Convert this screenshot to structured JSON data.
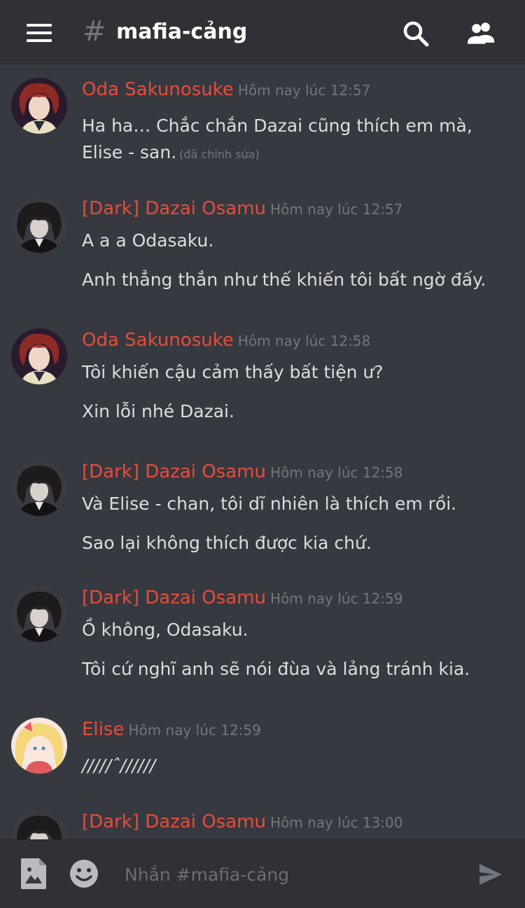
{
  "header": {
    "hash": "#",
    "channel": "mafia-cảng",
    "menu_icon": "hamburger-menu-icon",
    "search_icon": "search-icon",
    "members_icon": "members-icon"
  },
  "messages": [
    {
      "author": "Oda Sakunosuke",
      "timestamp": "Hôm nay lúc 12:57",
      "lines": [
        "Ha ha… Chắc chắn Dazai cũng thích em mà,",
        "Elise - san."
      ],
      "edited": "(đã chỉnh sửa)"
    },
    {
      "author": "[Dark] Dazai Osamu",
      "timestamp": "Hôm nay lúc 12:57",
      "lines": [
        "A a a Odasaku.",
        "Anh thẳng thắn như thế khiến tôi bất ngờ đấy."
      ]
    },
    {
      "author": "Oda Sakunosuke",
      "timestamp": "Hôm nay lúc 12:58",
      "lines": [
        "Tôi khiến cậu cảm thấy bất tiện ư?",
        "Xin lỗi nhé Dazai."
      ]
    },
    {
      "author": "[Dark] Dazai Osamu",
      "timestamp": "Hôm nay lúc 12:58",
      "lines": [
        "Và Elise - chan, tôi dĩ nhiên là thích em rồi.",
        "Sao lại không thích được kia chứ."
      ]
    },
    {
      "author": "[Dark] Dazai Osamu",
      "timestamp": "Hôm nay lúc 12:59",
      "lines": [
        "Ồ không, Odasaku.",
        "Tôi cứ nghĩ anh sẽ nói đùa và lảng tránh kia."
      ]
    },
    {
      "author": "Elise",
      "timestamp": "Hôm nay lúc 12:59",
      "lines": [
        "/////ˆ//////"
      ]
    },
    {
      "author": "[Dark] Dazai Osamu",
      "timestamp": "Hôm nay lúc 13:00",
      "lines": []
    }
  ],
  "composer": {
    "placeholder": "Nhắn #mafia-cảng",
    "image_icon": "image-upload-icon",
    "emoji_icon": "emoji-icon",
    "send_icon": "send-icon"
  },
  "colors": {
    "background": "#36393f",
    "header_bg": "#2f3136",
    "username": "#e74c3c",
    "timestamp": "#72767d",
    "text": "#dcddde"
  }
}
